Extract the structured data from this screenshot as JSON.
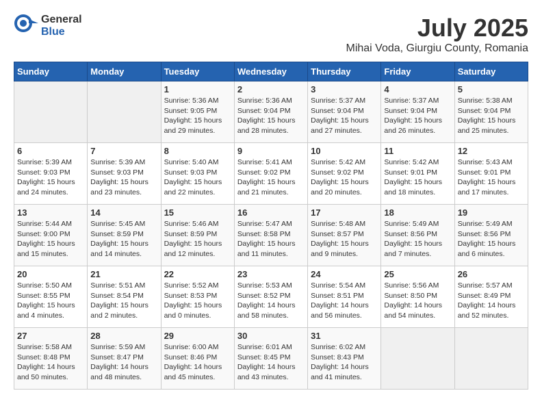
{
  "logo": {
    "general": "General",
    "blue": "Blue"
  },
  "title": {
    "month": "July 2025",
    "location": "Mihai Voda, Giurgiu County, Romania"
  },
  "weekdays": [
    "Sunday",
    "Monday",
    "Tuesday",
    "Wednesday",
    "Thursday",
    "Friday",
    "Saturday"
  ],
  "weeks": [
    [
      {
        "day": "",
        "info": ""
      },
      {
        "day": "",
        "info": ""
      },
      {
        "day": "1",
        "info": "Sunrise: 5:36 AM\nSunset: 9:05 PM\nDaylight: 15 hours and 29 minutes."
      },
      {
        "day": "2",
        "info": "Sunrise: 5:36 AM\nSunset: 9:04 PM\nDaylight: 15 hours and 28 minutes."
      },
      {
        "day": "3",
        "info": "Sunrise: 5:37 AM\nSunset: 9:04 PM\nDaylight: 15 hours and 27 minutes."
      },
      {
        "day": "4",
        "info": "Sunrise: 5:37 AM\nSunset: 9:04 PM\nDaylight: 15 hours and 26 minutes."
      },
      {
        "day": "5",
        "info": "Sunrise: 5:38 AM\nSunset: 9:04 PM\nDaylight: 15 hours and 25 minutes."
      }
    ],
    [
      {
        "day": "6",
        "info": "Sunrise: 5:39 AM\nSunset: 9:03 PM\nDaylight: 15 hours and 24 minutes."
      },
      {
        "day": "7",
        "info": "Sunrise: 5:39 AM\nSunset: 9:03 PM\nDaylight: 15 hours and 23 minutes."
      },
      {
        "day": "8",
        "info": "Sunrise: 5:40 AM\nSunset: 9:03 PM\nDaylight: 15 hours and 22 minutes."
      },
      {
        "day": "9",
        "info": "Sunrise: 5:41 AM\nSunset: 9:02 PM\nDaylight: 15 hours and 21 minutes."
      },
      {
        "day": "10",
        "info": "Sunrise: 5:42 AM\nSunset: 9:02 PM\nDaylight: 15 hours and 20 minutes."
      },
      {
        "day": "11",
        "info": "Sunrise: 5:42 AM\nSunset: 9:01 PM\nDaylight: 15 hours and 18 minutes."
      },
      {
        "day": "12",
        "info": "Sunrise: 5:43 AM\nSunset: 9:01 PM\nDaylight: 15 hours and 17 minutes."
      }
    ],
    [
      {
        "day": "13",
        "info": "Sunrise: 5:44 AM\nSunset: 9:00 PM\nDaylight: 15 hours and 15 minutes."
      },
      {
        "day": "14",
        "info": "Sunrise: 5:45 AM\nSunset: 8:59 PM\nDaylight: 15 hours and 14 minutes."
      },
      {
        "day": "15",
        "info": "Sunrise: 5:46 AM\nSunset: 8:59 PM\nDaylight: 15 hours and 12 minutes."
      },
      {
        "day": "16",
        "info": "Sunrise: 5:47 AM\nSunset: 8:58 PM\nDaylight: 15 hours and 11 minutes."
      },
      {
        "day": "17",
        "info": "Sunrise: 5:48 AM\nSunset: 8:57 PM\nDaylight: 15 hours and 9 minutes."
      },
      {
        "day": "18",
        "info": "Sunrise: 5:49 AM\nSunset: 8:56 PM\nDaylight: 15 hours and 7 minutes."
      },
      {
        "day": "19",
        "info": "Sunrise: 5:49 AM\nSunset: 8:56 PM\nDaylight: 15 hours and 6 minutes."
      }
    ],
    [
      {
        "day": "20",
        "info": "Sunrise: 5:50 AM\nSunset: 8:55 PM\nDaylight: 15 hours and 4 minutes."
      },
      {
        "day": "21",
        "info": "Sunrise: 5:51 AM\nSunset: 8:54 PM\nDaylight: 15 hours and 2 minutes."
      },
      {
        "day": "22",
        "info": "Sunrise: 5:52 AM\nSunset: 8:53 PM\nDaylight: 15 hours and 0 minutes."
      },
      {
        "day": "23",
        "info": "Sunrise: 5:53 AM\nSunset: 8:52 PM\nDaylight: 14 hours and 58 minutes."
      },
      {
        "day": "24",
        "info": "Sunrise: 5:54 AM\nSunset: 8:51 PM\nDaylight: 14 hours and 56 minutes."
      },
      {
        "day": "25",
        "info": "Sunrise: 5:56 AM\nSunset: 8:50 PM\nDaylight: 14 hours and 54 minutes."
      },
      {
        "day": "26",
        "info": "Sunrise: 5:57 AM\nSunset: 8:49 PM\nDaylight: 14 hours and 52 minutes."
      }
    ],
    [
      {
        "day": "27",
        "info": "Sunrise: 5:58 AM\nSunset: 8:48 PM\nDaylight: 14 hours and 50 minutes."
      },
      {
        "day": "28",
        "info": "Sunrise: 5:59 AM\nSunset: 8:47 PM\nDaylight: 14 hours and 48 minutes."
      },
      {
        "day": "29",
        "info": "Sunrise: 6:00 AM\nSunset: 8:46 PM\nDaylight: 14 hours and 45 minutes."
      },
      {
        "day": "30",
        "info": "Sunrise: 6:01 AM\nSunset: 8:45 PM\nDaylight: 14 hours and 43 minutes."
      },
      {
        "day": "31",
        "info": "Sunrise: 6:02 AM\nSunset: 8:43 PM\nDaylight: 14 hours and 41 minutes."
      },
      {
        "day": "",
        "info": ""
      },
      {
        "day": "",
        "info": ""
      }
    ]
  ]
}
